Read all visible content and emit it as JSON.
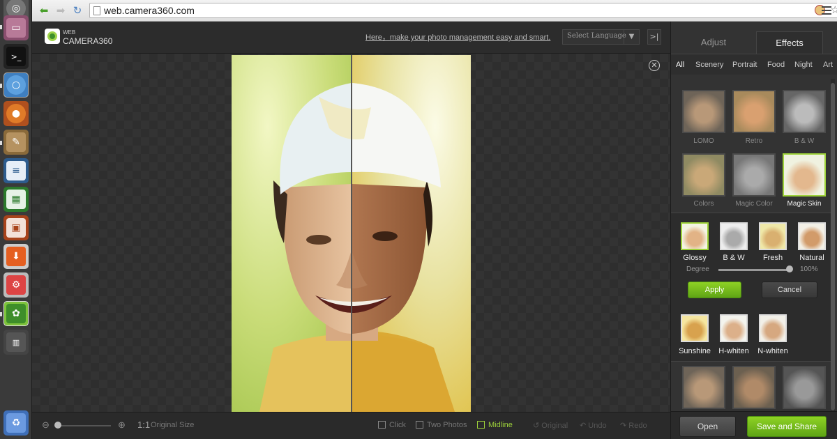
{
  "browser": {
    "url": "web.camera360.com"
  },
  "app": {
    "logo_web": "WEB",
    "logo_name": "CAMERA360",
    "tagline": "Here，make your photo management easy and smart.",
    "language_select": "Select Language",
    "collapse_label": ">|"
  },
  "bottom_toolbar": {
    "zoom_ratio": "1:1",
    "original_size": "Original Size",
    "click": "Click",
    "two_photos": "Two Photos",
    "midline": "Midline",
    "original": "Original",
    "undo": "Undo",
    "redo": "Redo",
    "zoom_level": 0.0
  },
  "panel": {
    "tabs": [
      {
        "label": "Adjust"
      },
      {
        "label": "Effects"
      }
    ],
    "active_tab": "Effects",
    "categories": [
      "All",
      "Scenery",
      "Portrait",
      "Food",
      "Night",
      "Art"
    ],
    "effects": [
      {
        "label": "LOMO"
      },
      {
        "label": "Retro"
      },
      {
        "label": "B & W"
      },
      {
        "label": "Colors"
      },
      {
        "label": "Magic Color"
      },
      {
        "label": "Magic Skin"
      }
    ],
    "selected_effect": "Magic Skin",
    "sub_effects": [
      {
        "label": "Glossy"
      },
      {
        "label": "B & W"
      },
      {
        "label": "Fresh"
      },
      {
        "label": "Natural"
      }
    ],
    "degree_label": "Degree",
    "degree_value": "100%",
    "degree_fraction": 1.0,
    "apply_label": "Apply",
    "cancel_label": "Cancel",
    "sub_effects_2": [
      {
        "label": "Sunshine"
      },
      {
        "label": "H-whiten"
      },
      {
        "label": "N-whiten"
      }
    ],
    "open_label": "Open",
    "save_share_label": "Save and Share"
  },
  "colors": {
    "accent_green": "#8dc21f",
    "panel_bg": "#333333"
  }
}
